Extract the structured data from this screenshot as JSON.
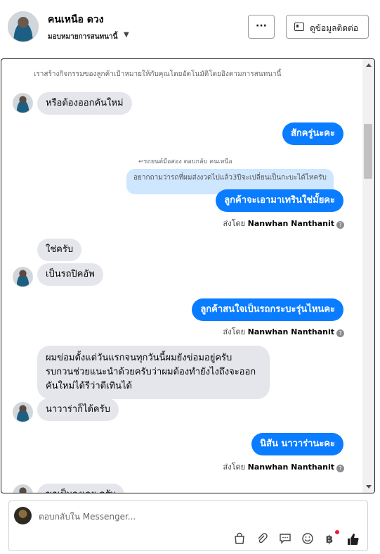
{
  "header": {
    "name": "คนเหนือ ดวง",
    "assign_label": "มอบหมายการสนทนานี้",
    "contact_button": "ดูข้อมูลติดต่อ",
    "more_button": "···"
  },
  "conversation": {
    "top_note": "เราสร้างกิจกรรมของลูกค้าเป้าหมายให้กับคุณโดยอัตโนมัติโดยอิงตามการสนทนานี้",
    "m1": "หรือต้องออกคันใหม่",
    "m2": "สักครู่นะคะ",
    "reply_label": "↩รถยนต์มือสอง ตอบกลับ คนเหนือ",
    "reply_quote": "อยากถามว่ารถที่ผมส่งงวดไปแล้ว3ปีจะเปลี่ยนเป็นกะบะได้ไหครับ",
    "m3": "ลูกค้าจะเอามาเทรินใช่มั้ยคะ",
    "sent_by_prefix": "ส่งโดย",
    "sender": "Nanwhan Nanthanit",
    "m4": "ใช่ครับ",
    "m5": "เป็นรถปิคอัพ",
    "m6": "ลูกค้าสนใจเป็นรถกระบะรุ่นไหนคะ",
    "m7": "ผมข่อมตั้งแต่วันแรกจนทุกวันนี้ผมยังข่อมอยู่ครับ รบกวนช่วยแนะนำด้วยครับว่าผมต้องทำยังไงถึงจะออกคันใหม่ได้รีว่าตีเทินได้",
    "m8": "นาวาร่าก็ได้ครับ",
    "m9": "นิสัน นาวาร่านะคะ",
    "m10": "ขอเป็นวงเลย ครับ"
  },
  "composer": {
    "placeholder": "ตอบกลับใน Messenger..."
  },
  "icons": [
    "bag-icon",
    "paperclip-icon",
    "chat-bubble-icon",
    "emoji-icon",
    "baht-icon",
    "thumbs-up-icon"
  ]
}
